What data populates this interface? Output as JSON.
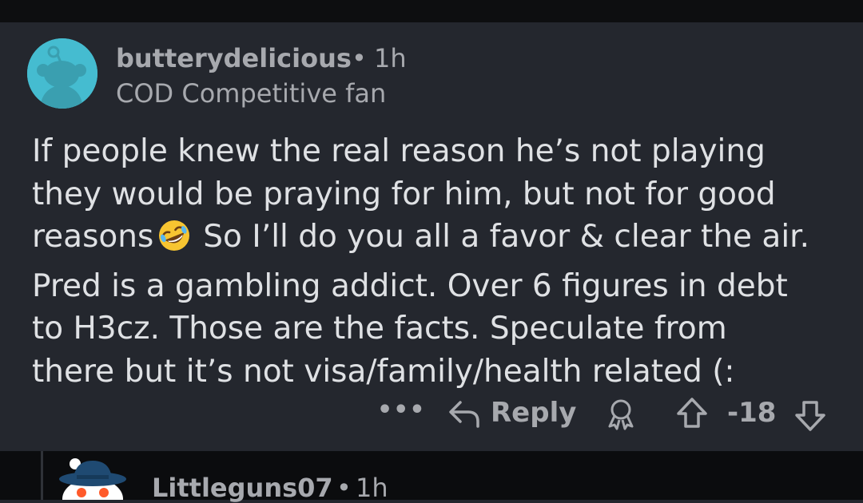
{
  "comment": {
    "author": "butterydelicious",
    "separator": "•",
    "time": "1h",
    "flair": "COD Competitive fan",
    "body": {
      "line1": "If people knew the real reason he’s not playing",
      "line2": "they would be praying for him, but not for good",
      "line3_before": "reasons",
      "line3_after": "So I’ll do you all a favor & clear the air.",
      "line4": "Pred is a gambling addict. Over 6 figures in debt",
      "line5": "to H3cz. Those are the facts. Speculate from",
      "line6": "there but it’s not visa/family/health related (:"
    },
    "emoji_icon": "rolling-on-floor-laughing-emoji",
    "actions": {
      "more_label": "•••",
      "reply_label": "Reply",
      "score": "-18"
    },
    "avatar_color": "#45bcd0"
  },
  "child_comment": {
    "author": "Littleguns07",
    "separator": "•",
    "time": "1h"
  },
  "colors": {
    "background": "#24272e",
    "text_primary": "#dfe1e4",
    "text_secondary": "#a7a9ae",
    "thread_background": "#0b0c0e"
  }
}
